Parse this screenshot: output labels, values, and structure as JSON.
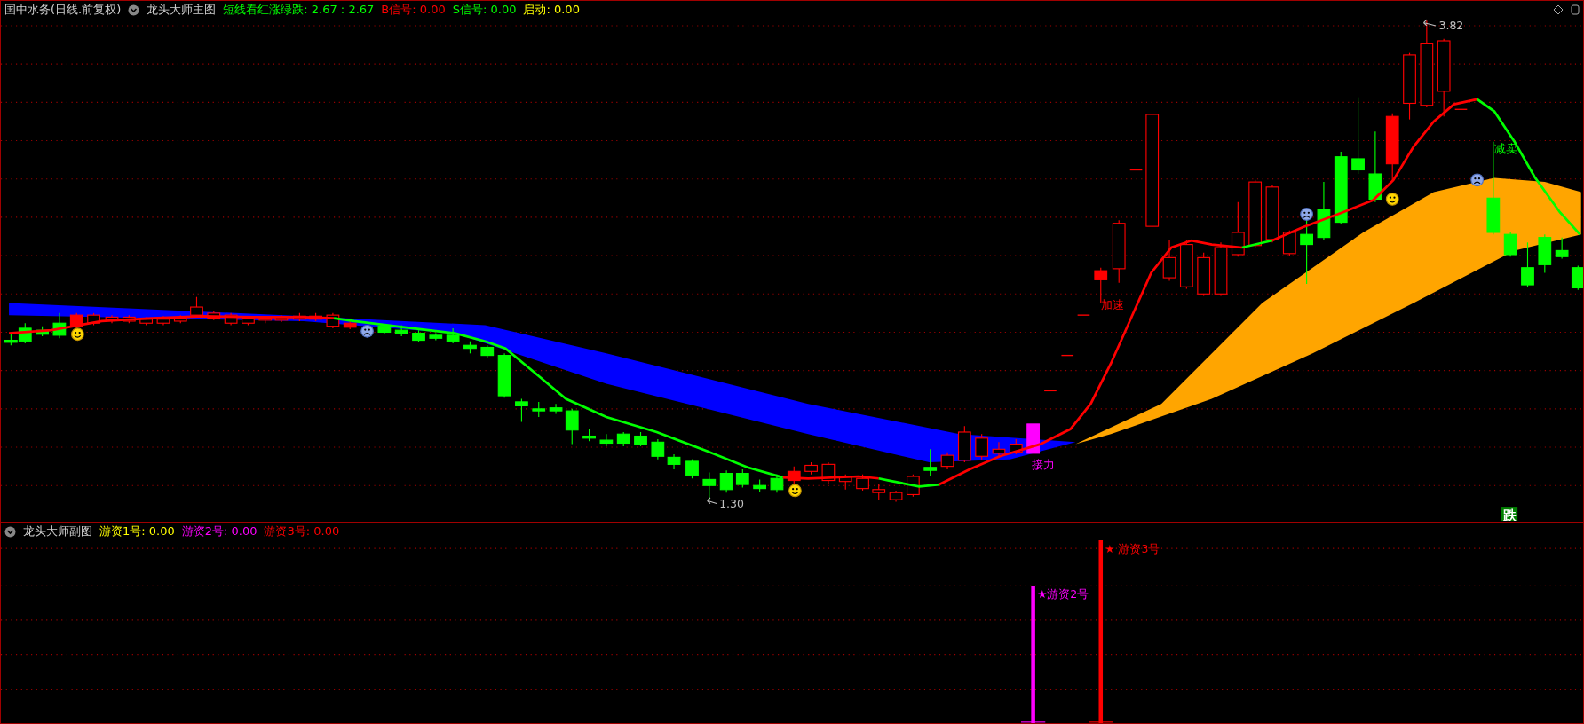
{
  "main_panel": {
    "stock": "国中水务(日线.前复权)",
    "indicator": "龙头大师主图",
    "values": [
      {
        "text": "短线看红涨绿跌: 2.67 : 2.67",
        "color": "#00ff00"
      },
      {
        "text": "B信号: 0.00",
        "color": "#ff0000"
      },
      {
        "text": "S信号: 0.00",
        "color": "#00ff00"
      },
      {
        "text": "启动: 0.00",
        "color": "#ffff00"
      }
    ],
    "annotations": [
      {
        "text": "3.82",
        "color": "#c0c0c0"
      },
      {
        "text": "1.30",
        "color": "#c0c0c0"
      },
      {
        "text": "加速",
        "color": "#ff0000"
      },
      {
        "text": "接力",
        "color": "#ff00ff"
      },
      {
        "text": "减卖",
        "color": "#00ff00"
      },
      {
        "text": "跌",
        "color": "#008000"
      }
    ]
  },
  "sub_panel": {
    "indicator": "龙头大师副图",
    "values": [
      {
        "text": "游资1号: 0.00",
        "color": "#ffff00"
      },
      {
        "text": "游资2号: 0.00",
        "color": "#ff00ff"
      },
      {
        "text": "游资3号: 0.00",
        "color": "#ff0000"
      }
    ],
    "signals": [
      {
        "text": "★游资2号",
        "color": "#ff00ff"
      },
      {
        "text": "★ 游资3号",
        "color": "#ff0000"
      }
    ]
  }
}
